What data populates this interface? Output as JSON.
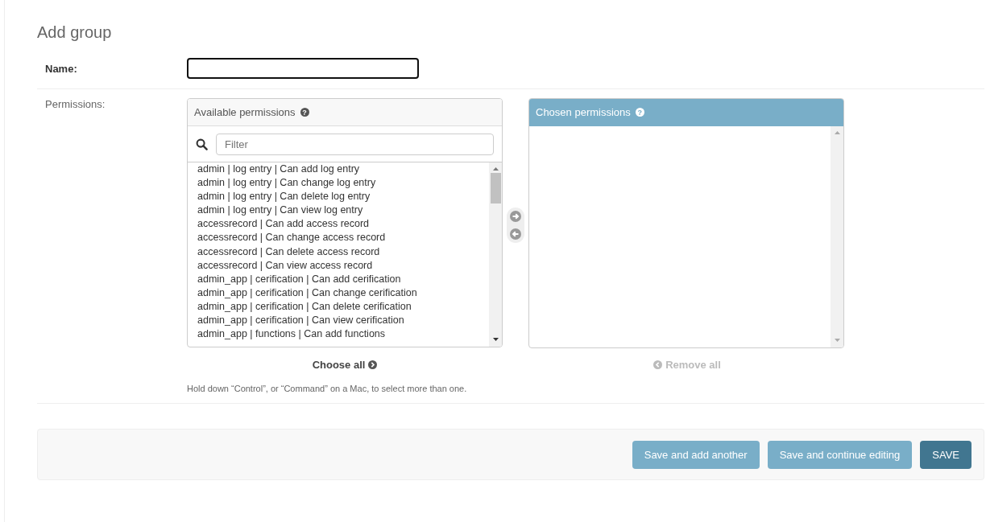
{
  "title": "Add group",
  "name_field": {
    "label": "Name:"
  },
  "permissions": {
    "label": "Permissions:",
    "available": {
      "title": "Available permissions",
      "help": "?",
      "filter_placeholder": "Filter",
      "items": [
        "admin | log entry | Can add log entry",
        "admin | log entry | Can change log entry",
        "admin | log entry | Can delete log entry",
        "admin | log entry | Can view log entry",
        "accessrecord | Can add access record",
        "accessrecord | Can change access record",
        "accessrecord | Can delete access record",
        "accessrecord | Can view access record",
        "admin_app | cerification | Can add cerification",
        "admin_app | cerification | Can change cerification",
        "admin_app | cerification | Can delete cerification",
        "admin_app | cerification | Can view cerification",
        "admin_app | functions | Can add functions"
      ]
    },
    "chosen": {
      "title": "Chosen permissions",
      "help": "?"
    },
    "add_arrow": {
      "disabled": true
    },
    "remove_arrow": {
      "disabled": true
    },
    "choose_all": {
      "label": "Choose all",
      "disabled": false
    },
    "remove_all": {
      "label": "Remove all",
      "disabled": true
    },
    "help_text": "Hold down “Control”, or “Command” on a Mac, to select more than one."
  },
  "buttons": [
    {
      "label": "Save and add another",
      "kind": "secondary"
    },
    {
      "label": "Save and continue editing",
      "kind": "secondary"
    },
    {
      "label": "SAVE",
      "kind": "primary"
    }
  ]
}
